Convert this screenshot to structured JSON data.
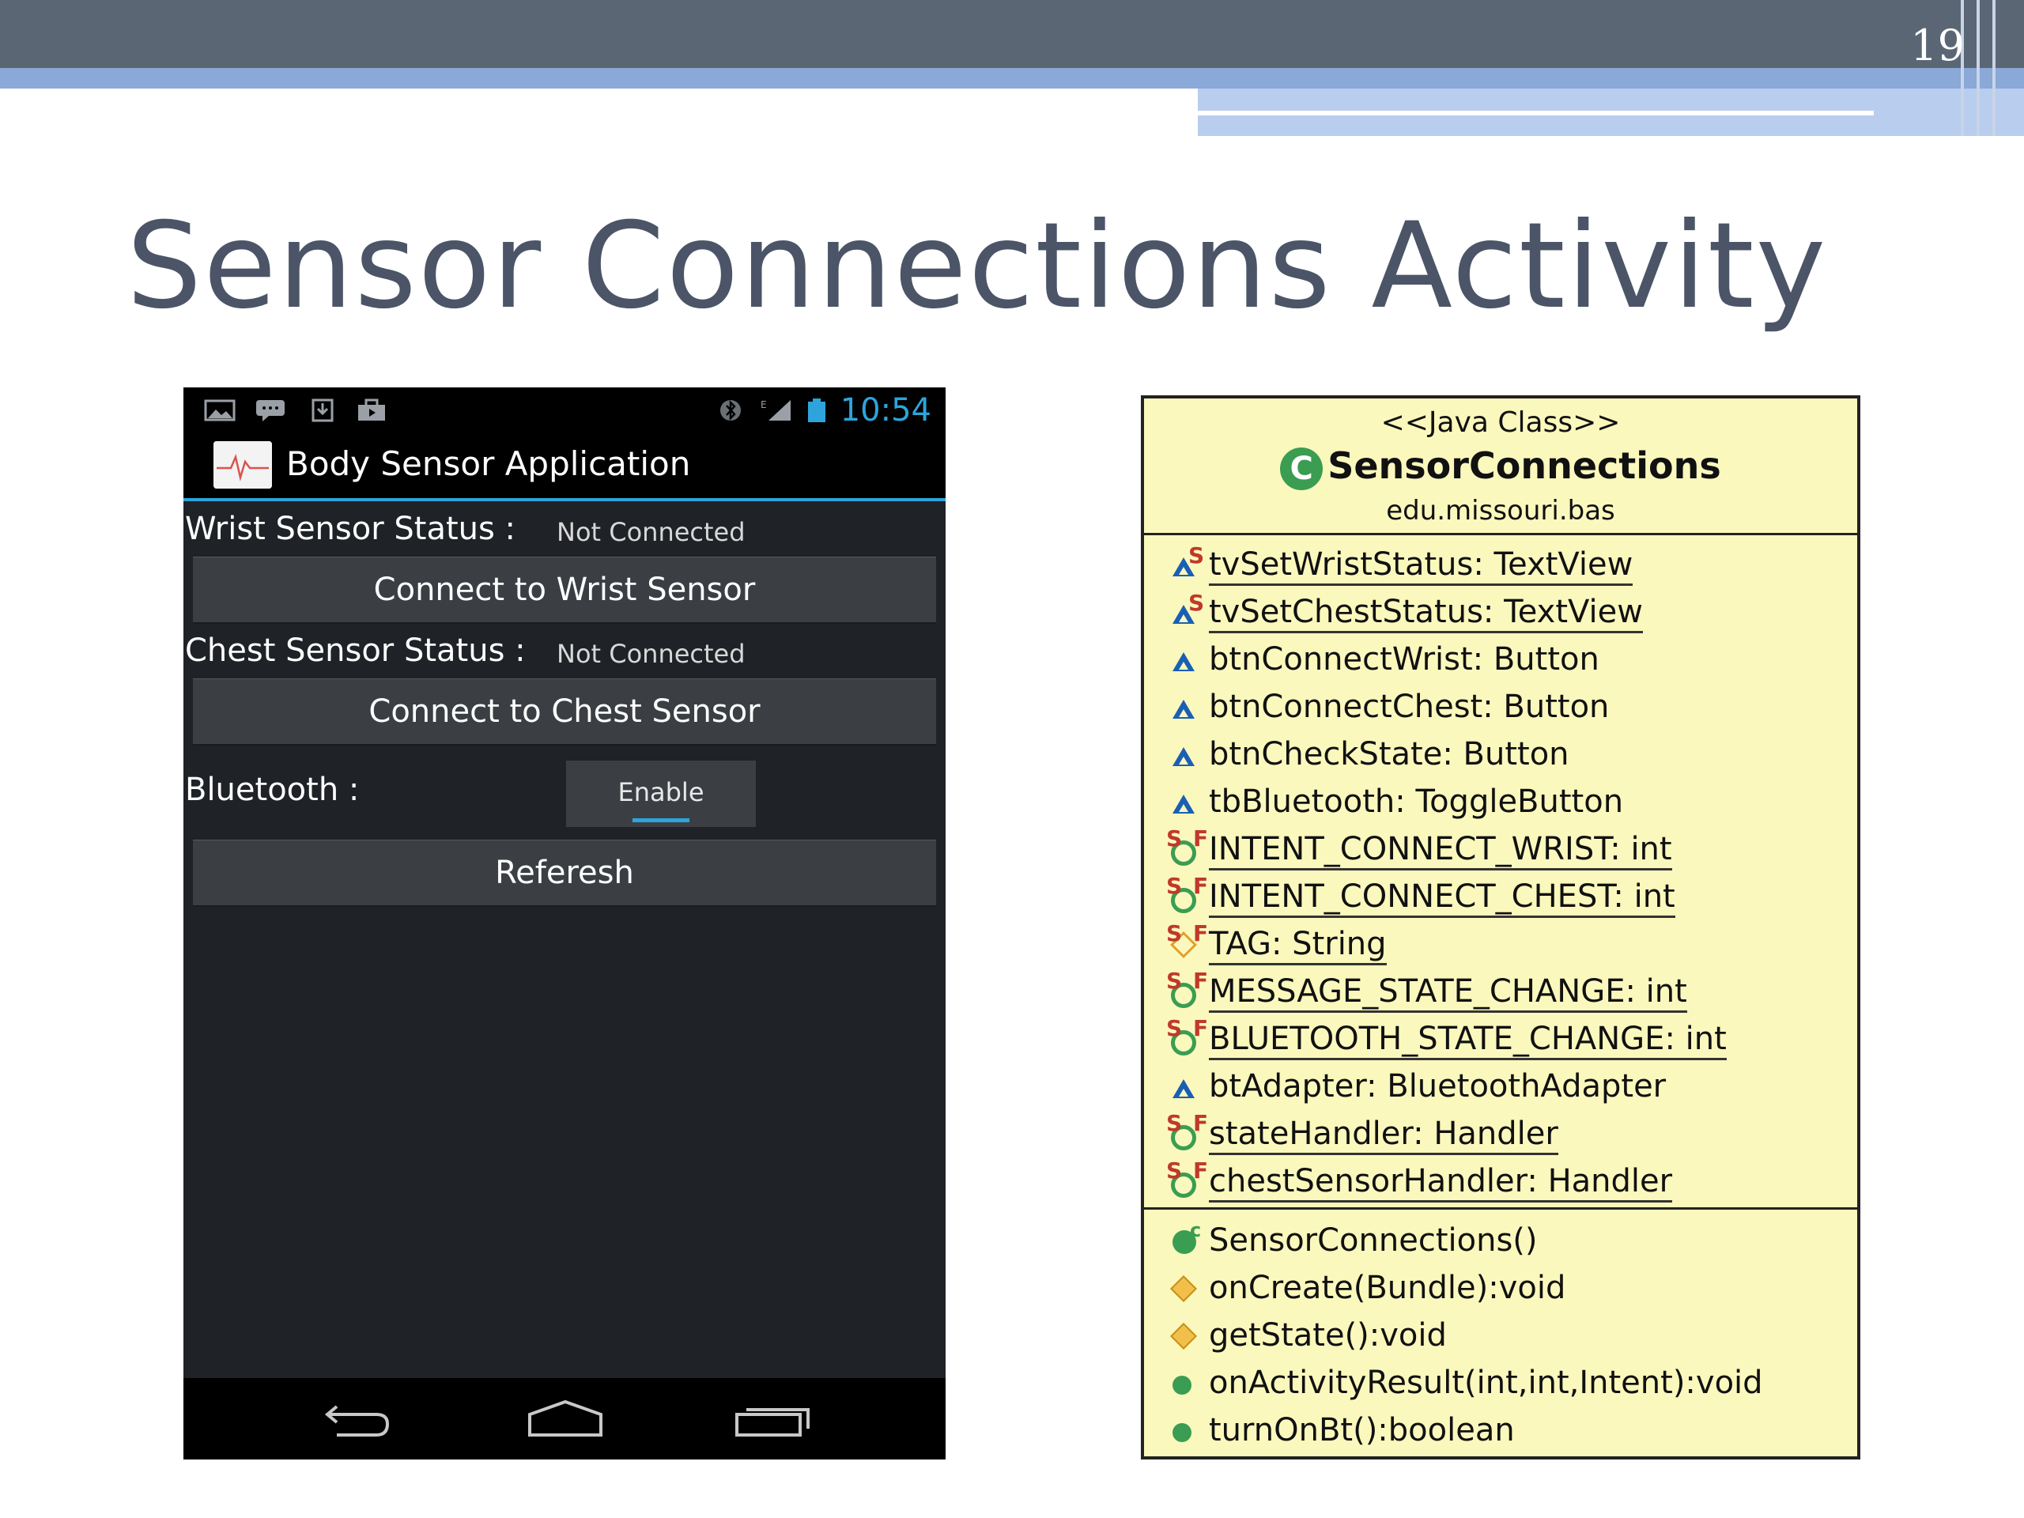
{
  "slide": {
    "page_number": "19",
    "title": "Sensor Connections Activity"
  },
  "phone": {
    "status_bar": {
      "time": "10:54",
      "icons": [
        "picture-icon",
        "message-icon",
        "download-icon",
        "bag-icon",
        "bluetooth-icon",
        "signal-icon",
        "battery-icon"
      ]
    },
    "action_bar": {
      "app_title": "Body Sensor Application"
    },
    "wrist": {
      "status_label": "Wrist Sensor Status :",
      "status_value": "Not Connected",
      "button_label": "Connect to Wrist Sensor"
    },
    "chest": {
      "status_label": "Chest Sensor Status :",
      "status_value": "Not Connected",
      "button_label": "Connect to Chest Sensor"
    },
    "bluetooth": {
      "label": "Bluetooth :",
      "toggle_label": "Enable"
    },
    "refresh_label": "Referesh",
    "nav_icons": [
      "back-icon",
      "home-icon",
      "recent-apps-icon"
    ]
  },
  "uml": {
    "stereotype": "<<Java Class>>",
    "class_name": "SensorConnections",
    "package": "edu.missouri.bas",
    "fields": [
      {
        "text": "tvSetWristStatus: TextView",
        "icon": "protected-static-field-icon"
      },
      {
        "text": "tvSetChestStatus: TextView",
        "icon": "protected-static-field-icon"
      },
      {
        "text": "btnConnectWrist: Button",
        "icon": "protected-field-icon"
      },
      {
        "text": "btnConnectChest: Button",
        "icon": "protected-field-icon"
      },
      {
        "text": "btnCheckState: Button",
        "icon": "protected-field-icon"
      },
      {
        "text": "tbBluetooth: ToggleButton",
        "icon": "protected-field-icon"
      },
      {
        "text": "INTENT_CONNECT_WRIST: int",
        "icon": "public-static-final-field-icon"
      },
      {
        "text": "INTENT_CONNECT_CHEST: int",
        "icon": "public-static-final-field-icon"
      },
      {
        "text": "TAG: String",
        "icon": "private-static-final-field-icon"
      },
      {
        "text": "MESSAGE_STATE_CHANGE: int",
        "icon": "public-static-final-field-icon"
      },
      {
        "text": "BLUETOOTH_STATE_CHANGE: int",
        "icon": "public-static-final-field-icon"
      },
      {
        "text": "btAdapter: BluetoothAdapter",
        "icon": "protected-field-icon"
      },
      {
        "text": "stateHandler: Handler",
        "icon": "public-static-final-field-icon"
      },
      {
        "text": "chestSensorHandler: Handler",
        "icon": "public-static-final-field-icon"
      }
    ],
    "methods": [
      {
        "text": "SensorConnections()",
        "icon": "constructor-icon"
      },
      {
        "text": "onCreate(Bundle):void",
        "icon": "protected-method-icon"
      },
      {
        "text": "getState():void",
        "icon": "protected-method-icon"
      },
      {
        "text": "onActivityResult(int,int,Intent):void",
        "icon": "public-method-icon"
      },
      {
        "text": "turnOnBt():boolean",
        "icon": "public-method-icon"
      }
    ],
    "colors": {
      "background": "#fbf8bd",
      "public": "#3a9d52",
      "protected": "#1a5fb4",
      "private": "#e0a22a"
    }
  }
}
